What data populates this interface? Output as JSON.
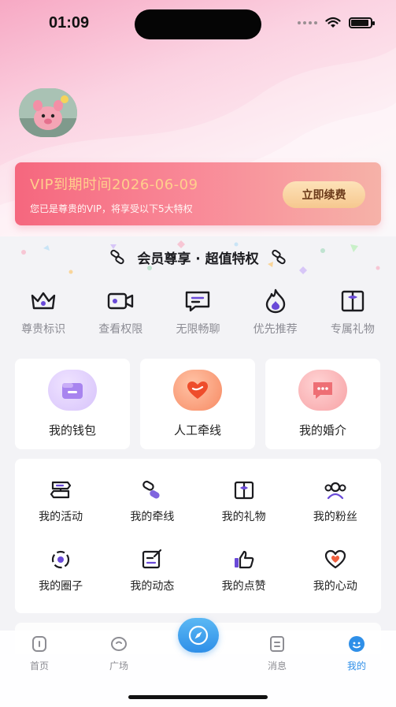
{
  "status_bar": {
    "time": "01:09"
  },
  "vip": {
    "expiry_text": "VIP到期时间2026-06-09",
    "subtitle": "您已是尊贵的VIP，将享受以下5大特权",
    "renew_button": "立即续费"
  },
  "privileges_section": {
    "heading": "会员尊享 · 超值特权",
    "items": [
      {
        "label": "尊贵标识",
        "icon": "crown-icon"
      },
      {
        "label": "查看权限",
        "icon": "video-camera-icon"
      },
      {
        "label": "无限畅聊",
        "icon": "chat-icon"
      },
      {
        "label": "优先推荐",
        "icon": "flame-icon"
      },
      {
        "label": "专属礼物",
        "icon": "gift-icon"
      }
    ]
  },
  "big_cards": [
    {
      "label": "我的钱包",
      "icon": "wallet-icon",
      "color": "#b48cf0"
    },
    {
      "label": "人工牵线",
      "icon": "heart-icon",
      "color": "#f2623a"
    },
    {
      "label": "我的婚介",
      "icon": "message-icon",
      "color": "#f0727a"
    }
  ],
  "grid_items": [
    {
      "label": "我的活动",
      "icon": "signpost-icon"
    },
    {
      "label": "我的牵线",
      "icon": "link-icon"
    },
    {
      "label": "我的礼物",
      "icon": "gift-icon"
    },
    {
      "label": "我的粉丝",
      "icon": "fans-icon"
    },
    {
      "label": "我的圈子",
      "icon": "circle-target-icon"
    },
    {
      "label": "我的动态",
      "icon": "edit-icon"
    },
    {
      "label": "我的点赞",
      "icon": "thumbs-up-icon"
    },
    {
      "label": "我的心动",
      "icon": "heart-outline-icon"
    }
  ],
  "tab_bar": {
    "tabs": [
      {
        "label": "首页",
        "icon": "home-icon"
      },
      {
        "label": "广场",
        "icon": "square-icon"
      },
      {
        "label": "",
        "icon": "compass-icon"
      },
      {
        "label": "消息",
        "icon": "message-box-icon"
      },
      {
        "label": "我的",
        "icon": "profile-icon"
      }
    ],
    "active": "我的"
  },
  "colors": {
    "accent": "#2f8fe8",
    "vip_gradient_start": "#f5677e",
    "vip_title": "#ffcf8c",
    "icon_purple": "#6a4ad8"
  }
}
